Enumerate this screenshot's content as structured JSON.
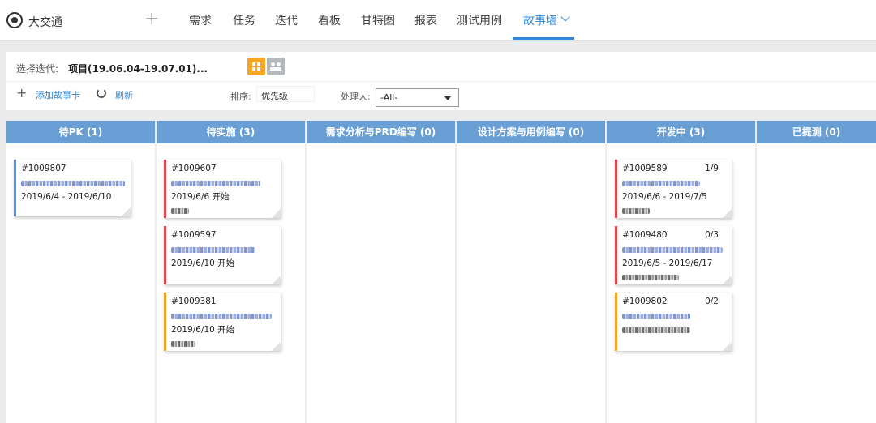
{
  "app": {
    "title": "大交通"
  },
  "nav": {
    "add_symbol": "+",
    "items": [
      "需求",
      "任务",
      "迭代",
      "看板",
      "甘特图",
      "报表",
      "测试用例",
      "故事墙"
    ],
    "active": "故事墙"
  },
  "toolbar": {
    "iteration_label": "选择迭代:",
    "iteration_value": "项目(19.06.04-19.07.01)...",
    "add_icon": "+",
    "add_label": "添加故事卡",
    "refresh_label": "刷新",
    "sort_label": "排序:",
    "sort_value": "优先级",
    "handler_label": "处理人:",
    "handler_value": "-All-"
  },
  "colors": {
    "accent": "#2f87d6",
    "column_header": "#6a9fd5",
    "red": "#e0454b",
    "yellow": "#f0a623",
    "blue": "#4a90e2",
    "view_active": "#f5a623"
  },
  "columns": [
    {
      "title": "待PK (1)",
      "cards": [
        {
          "id": "#1009807",
          "count": "",
          "color": "blue",
          "date": "2019/6/4 - 2019/6/10"
        }
      ]
    },
    {
      "title": "待实施 (3)",
      "cards": [
        {
          "id": "#1009607",
          "count": "",
          "color": "red",
          "date": "2019/6/6 开始"
        },
        {
          "id": "#1009597",
          "count": "",
          "color": "red",
          "date": "2019/6/10 开始"
        },
        {
          "id": "#1009381",
          "count": "",
          "color": "yellow",
          "date": "2019/6/10 开始"
        }
      ]
    },
    {
      "title": "需求分析与PRD编写 (0)",
      "cards": []
    },
    {
      "title": "设计方案与用例编写 (0)",
      "cards": []
    },
    {
      "title": "开发中 (3)",
      "cards": [
        {
          "id": "#1009589",
          "count": "1/9",
          "color": "red",
          "date": "2019/6/6 - 2019/7/5"
        },
        {
          "id": "#1009480",
          "count": "0/3",
          "color": "red",
          "date": "2019/6/5 - 2019/6/17"
        },
        {
          "id": "#1009802",
          "count": "0/2",
          "color": "yellow",
          "date": ""
        }
      ]
    },
    {
      "title": "已提测 (0)",
      "cards": []
    }
  ]
}
